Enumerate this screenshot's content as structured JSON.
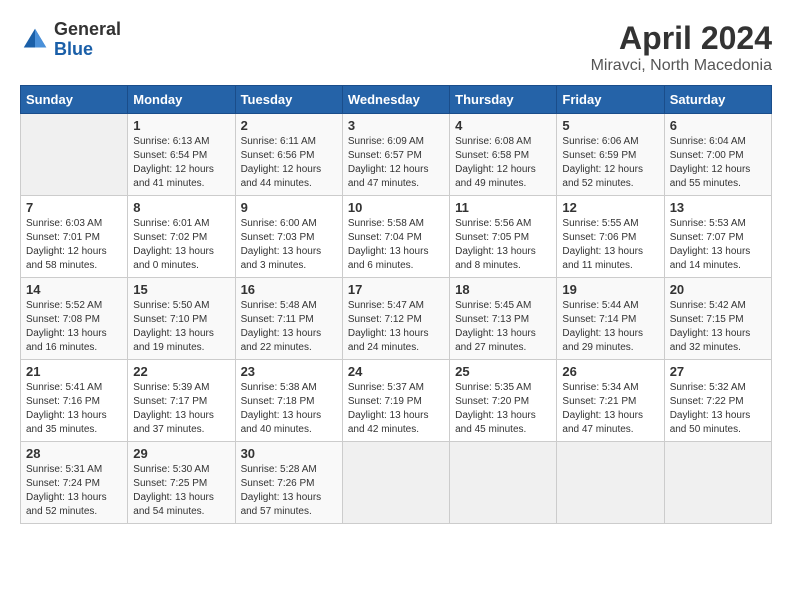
{
  "header": {
    "logo_general": "General",
    "logo_blue": "Blue",
    "title": "April 2024",
    "subtitle": "Miravci, North Macedonia"
  },
  "calendar": {
    "weekdays": [
      "Sunday",
      "Monday",
      "Tuesday",
      "Wednesday",
      "Thursday",
      "Friday",
      "Saturday"
    ],
    "weeks": [
      [
        {
          "day": "",
          "info": ""
        },
        {
          "day": "1",
          "info": "Sunrise: 6:13 AM\nSunset: 6:54 PM\nDaylight: 12 hours\nand 41 minutes."
        },
        {
          "day": "2",
          "info": "Sunrise: 6:11 AM\nSunset: 6:56 PM\nDaylight: 12 hours\nand 44 minutes."
        },
        {
          "day": "3",
          "info": "Sunrise: 6:09 AM\nSunset: 6:57 PM\nDaylight: 12 hours\nand 47 minutes."
        },
        {
          "day": "4",
          "info": "Sunrise: 6:08 AM\nSunset: 6:58 PM\nDaylight: 12 hours\nand 49 minutes."
        },
        {
          "day": "5",
          "info": "Sunrise: 6:06 AM\nSunset: 6:59 PM\nDaylight: 12 hours\nand 52 minutes."
        },
        {
          "day": "6",
          "info": "Sunrise: 6:04 AM\nSunset: 7:00 PM\nDaylight: 12 hours\nand 55 minutes."
        }
      ],
      [
        {
          "day": "7",
          "info": "Sunrise: 6:03 AM\nSunset: 7:01 PM\nDaylight: 12 hours\nand 58 minutes."
        },
        {
          "day": "8",
          "info": "Sunrise: 6:01 AM\nSunset: 7:02 PM\nDaylight: 13 hours\nand 0 minutes."
        },
        {
          "day": "9",
          "info": "Sunrise: 6:00 AM\nSunset: 7:03 PM\nDaylight: 13 hours\nand 3 minutes."
        },
        {
          "day": "10",
          "info": "Sunrise: 5:58 AM\nSunset: 7:04 PM\nDaylight: 13 hours\nand 6 minutes."
        },
        {
          "day": "11",
          "info": "Sunrise: 5:56 AM\nSunset: 7:05 PM\nDaylight: 13 hours\nand 8 minutes."
        },
        {
          "day": "12",
          "info": "Sunrise: 5:55 AM\nSunset: 7:06 PM\nDaylight: 13 hours\nand 11 minutes."
        },
        {
          "day": "13",
          "info": "Sunrise: 5:53 AM\nSunset: 7:07 PM\nDaylight: 13 hours\nand 14 minutes."
        }
      ],
      [
        {
          "day": "14",
          "info": "Sunrise: 5:52 AM\nSunset: 7:08 PM\nDaylight: 13 hours\nand 16 minutes."
        },
        {
          "day": "15",
          "info": "Sunrise: 5:50 AM\nSunset: 7:10 PM\nDaylight: 13 hours\nand 19 minutes."
        },
        {
          "day": "16",
          "info": "Sunrise: 5:48 AM\nSunset: 7:11 PM\nDaylight: 13 hours\nand 22 minutes."
        },
        {
          "day": "17",
          "info": "Sunrise: 5:47 AM\nSunset: 7:12 PM\nDaylight: 13 hours\nand 24 minutes."
        },
        {
          "day": "18",
          "info": "Sunrise: 5:45 AM\nSunset: 7:13 PM\nDaylight: 13 hours\nand 27 minutes."
        },
        {
          "day": "19",
          "info": "Sunrise: 5:44 AM\nSunset: 7:14 PM\nDaylight: 13 hours\nand 29 minutes."
        },
        {
          "day": "20",
          "info": "Sunrise: 5:42 AM\nSunset: 7:15 PM\nDaylight: 13 hours\nand 32 minutes."
        }
      ],
      [
        {
          "day": "21",
          "info": "Sunrise: 5:41 AM\nSunset: 7:16 PM\nDaylight: 13 hours\nand 35 minutes."
        },
        {
          "day": "22",
          "info": "Sunrise: 5:39 AM\nSunset: 7:17 PM\nDaylight: 13 hours\nand 37 minutes."
        },
        {
          "day": "23",
          "info": "Sunrise: 5:38 AM\nSunset: 7:18 PM\nDaylight: 13 hours\nand 40 minutes."
        },
        {
          "day": "24",
          "info": "Sunrise: 5:37 AM\nSunset: 7:19 PM\nDaylight: 13 hours\nand 42 minutes."
        },
        {
          "day": "25",
          "info": "Sunrise: 5:35 AM\nSunset: 7:20 PM\nDaylight: 13 hours\nand 45 minutes."
        },
        {
          "day": "26",
          "info": "Sunrise: 5:34 AM\nSunset: 7:21 PM\nDaylight: 13 hours\nand 47 minutes."
        },
        {
          "day": "27",
          "info": "Sunrise: 5:32 AM\nSunset: 7:22 PM\nDaylight: 13 hours\nand 50 minutes."
        }
      ],
      [
        {
          "day": "28",
          "info": "Sunrise: 5:31 AM\nSunset: 7:24 PM\nDaylight: 13 hours\nand 52 minutes."
        },
        {
          "day": "29",
          "info": "Sunrise: 5:30 AM\nSunset: 7:25 PM\nDaylight: 13 hours\nand 54 minutes."
        },
        {
          "day": "30",
          "info": "Sunrise: 5:28 AM\nSunset: 7:26 PM\nDaylight: 13 hours\nand 57 minutes."
        },
        {
          "day": "",
          "info": ""
        },
        {
          "day": "",
          "info": ""
        },
        {
          "day": "",
          "info": ""
        },
        {
          "day": "",
          "info": ""
        }
      ]
    ]
  }
}
